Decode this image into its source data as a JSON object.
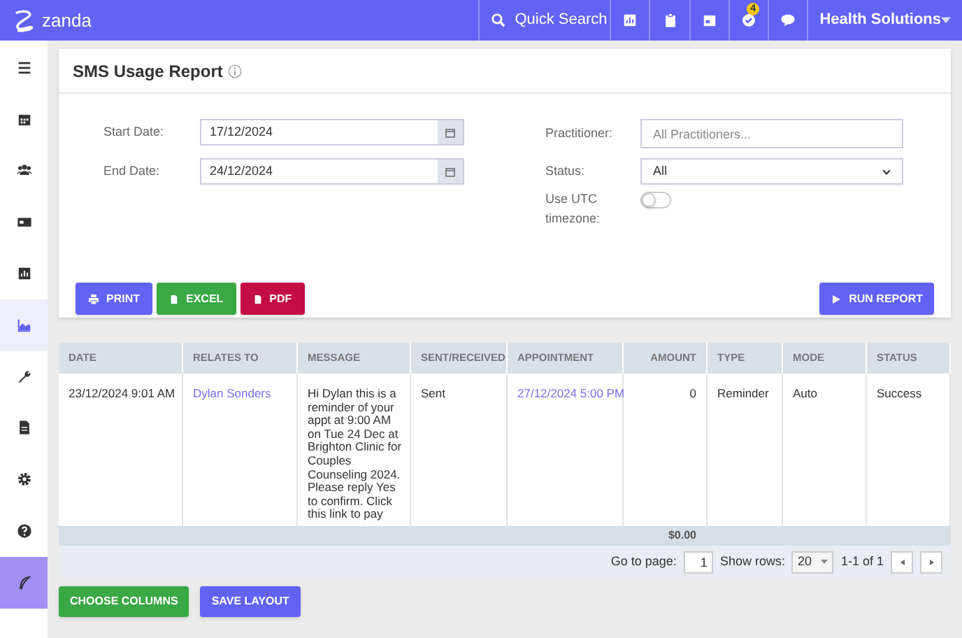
{
  "topbar": {
    "logo": "zanda",
    "search": "Quick Search",
    "badge": "4",
    "account": "Health Solutions"
  },
  "sidebar": {
    "items": [
      {
        "kind": "menu",
        "selected": false
      },
      {
        "kind": "calendar",
        "selected": false
      },
      {
        "kind": "people",
        "selected": false
      },
      {
        "kind": "card",
        "selected": false
      },
      {
        "kind": "chart",
        "selected": false
      },
      {
        "kind": "area",
        "selected": true
      },
      {
        "kind": "wrench",
        "selected": false
      },
      {
        "kind": "doc",
        "selected": false
      },
      {
        "kind": "gear",
        "selected": false
      },
      {
        "kind": "help",
        "selected": false
      },
      {
        "kind": "feather",
        "selected": false
      }
    ]
  },
  "report": {
    "title": "SMS Usage Report",
    "start_label": "Start Date:",
    "start_value": "17/12/2024",
    "end_label": "End Date:",
    "end_value": "24/12/2024",
    "practitioner_label": "Practitioner:",
    "practitioner_placeholder": "All Practitioners...",
    "status_label": "Status:",
    "status_value": "All",
    "utc_label": "Use UTC timezone:",
    "utc_on": false,
    "buttons": [
      "PRINT",
      "EXCEL",
      "PDF"
    ],
    "run": "RUN REPORT"
  },
  "table": {
    "columns": [
      "DATE",
      "RELATES TO",
      "MESSAGE",
      "SENT/RECEIVED",
      "APPOINTMENT",
      "AMOUNT",
      "TYPE",
      "MODE",
      "STATUS"
    ],
    "rows": [
      [
        "23/12/2024 9:01 AM",
        "Dylan Sonders",
        "Hi Dylan this is a reminder of your appt at 9:00 AM on Tue 24 Dec at Brighton Clinic for Couples Counseling 2024. Please reply Yes to confirm. Click this link to pay",
        "Sent",
        "27/12/2024 5:00 PM",
        "0",
        "Reminder",
        "Auto",
        "Success"
      ]
    ],
    "total": "$0.00",
    "goto_label": "Go to page:",
    "goto_value": "1",
    "rows_label": "Show rows:",
    "rows_value": "20",
    "range": "1-1 of 1"
  },
  "footer_buttons": [
    "CHOOSE COLUMNS",
    "SAVE LAYOUT"
  ]
}
